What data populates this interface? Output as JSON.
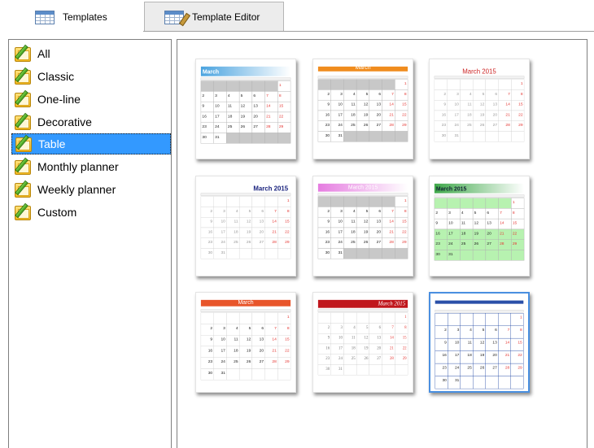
{
  "tabs": [
    {
      "label": "Templates",
      "icon": "calendar-table-icon",
      "active": true
    },
    {
      "label": "Template Editor",
      "icon": "calendar-edit-icon",
      "active": false
    }
  ],
  "categories": [
    {
      "label": "All"
    },
    {
      "label": "Classic"
    },
    {
      "label": "One-line"
    },
    {
      "label": "Decorative"
    },
    {
      "label": "Table",
      "selected": true
    },
    {
      "label": "Monthly planner"
    },
    {
      "label": "Weekly planner"
    },
    {
      "label": "Custom"
    }
  ],
  "templates": [
    {
      "title": "March",
      "header_color": "#4aa3df",
      "style": "blue-gradient"
    },
    {
      "title": "March",
      "header_color": "#f08c1e",
      "style": "orange-bar"
    },
    {
      "title": "March 2015",
      "header_color": "#ffffff",
      "title_color": "#cc2222",
      "style": "plain-red-title"
    },
    {
      "title": "March 2015",
      "header_color": "#ffffff",
      "title_color": "#1a237e",
      "style": "plain-navy-title"
    },
    {
      "title": "March 2015",
      "header_color": "#e57ce0",
      "style": "pink-gradient"
    },
    {
      "title": "March 2015",
      "header_color": "#3fa84a",
      "style": "green-gradient"
    },
    {
      "title": "March",
      "header_color": "#e8552a",
      "style": "red-orange-bar"
    },
    {
      "title": "March 2015",
      "header_color": "#c0161c",
      "style": "dark-red-script"
    },
    {
      "title": "",
      "header_color": "#2a4fa8",
      "style": "blue-lined",
      "selected": true
    }
  ],
  "colors": {
    "selection": "#3399ff",
    "weekend": "#e53935"
  }
}
